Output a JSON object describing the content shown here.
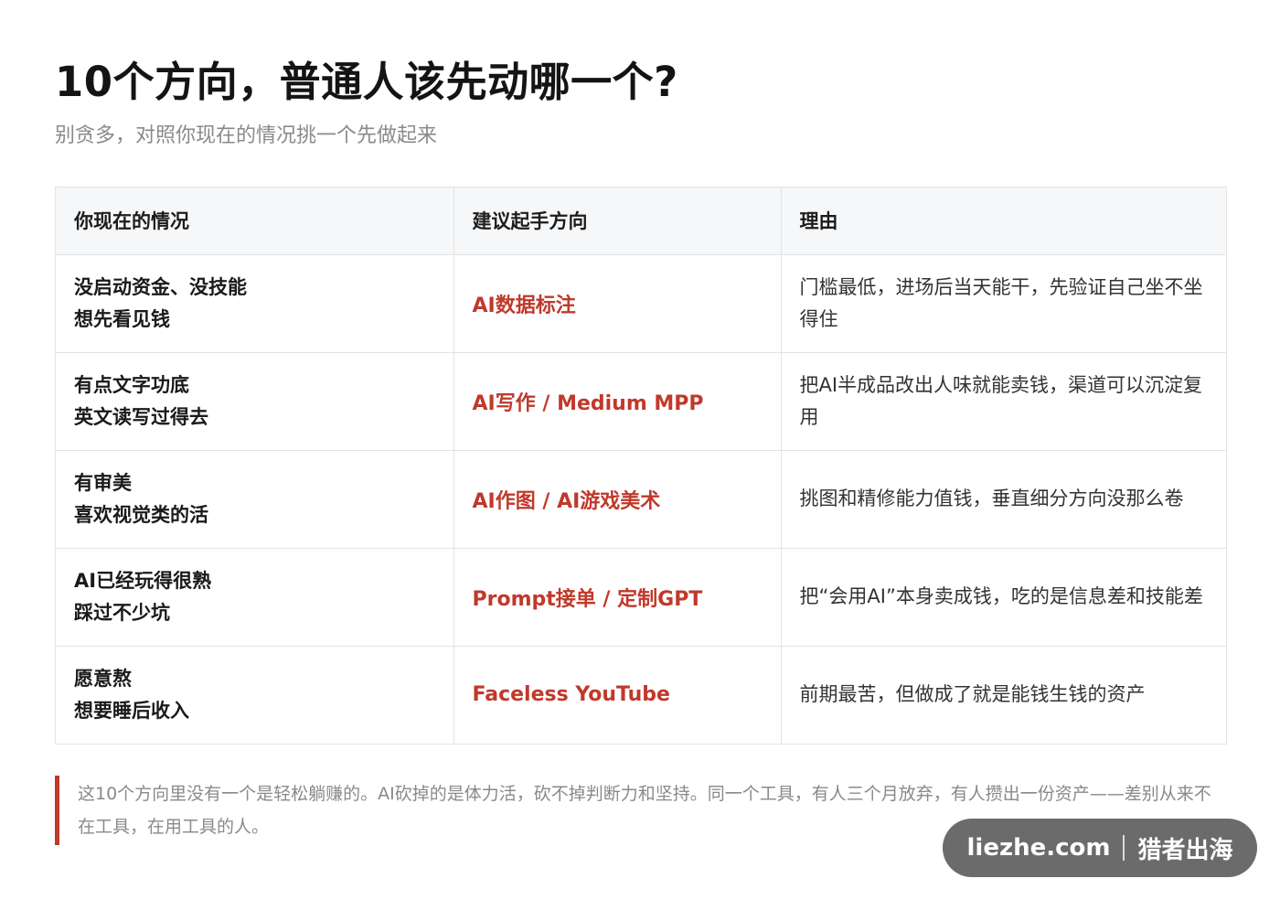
{
  "header": {
    "title": "10个方向，普通人该先动哪一个?",
    "subtitle": "别贪多，对照你现在的情况挑一个先做起来"
  },
  "table": {
    "columns": [
      "你现在的情况",
      "建议起手方向",
      "理由"
    ],
    "rows": [
      {
        "situation": [
          "没启动资金、没技能",
          "想先看见钱"
        ],
        "direction": "AI数据标注",
        "reason": "门槛最低，进场后当天能干，先验证自己坐不坐得住"
      },
      {
        "situation": [
          "有点文字功底",
          "英文读写过得去"
        ],
        "direction": "AI写作 / Medium MPP",
        "reason": "把AI半成品改出人味就能卖钱，渠道可以沉淀复用"
      },
      {
        "situation": [
          "有审美",
          "喜欢视觉类的活"
        ],
        "direction": "AI作图 / AI游戏美术",
        "reason": "挑图和精修能力值钱，垂直细分方向没那么卷"
      },
      {
        "situation": [
          "AI已经玩得很熟",
          "踩过不少坑"
        ],
        "direction": "Prompt接单 / 定制GPT",
        "reason": "把“会用AI”本身卖成钱，吃的是信息差和技能差"
      },
      {
        "situation": [
          "愿意熬",
          "想要睡后收入"
        ],
        "direction": "Faceless YouTube",
        "reason": "前期最苦，但做成了就是能钱生钱的资产"
      }
    ]
  },
  "note": {
    "text": "这10个方向里没有一个是轻松躺赚的。AI砍掉的是体力活，砍不掉判断力和坚持。同一个工具，有人三个月放弃，有人攒出一份资产——差别从来不在工具，在用工具的人。"
  },
  "watermark": {
    "site": "liezhe.com",
    "brand": "猎者出海"
  },
  "colors": {
    "accent": "#c0392b",
    "header_bg": "#f6f7f9",
    "border": "#e3e3e3",
    "muted_text": "#8a8a8a"
  }
}
